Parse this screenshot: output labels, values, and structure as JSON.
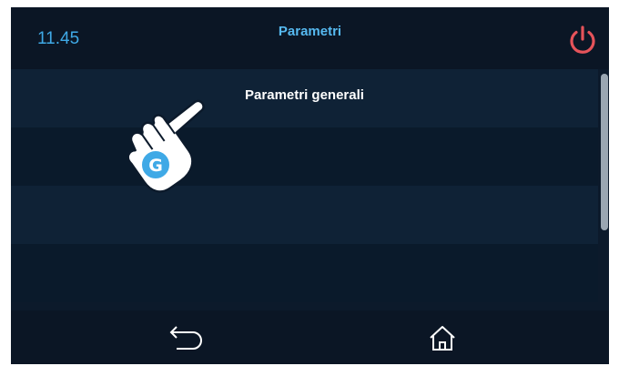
{
  "status_bar": {
    "time": "11.45",
    "title": "Parametri",
    "power_icon": "power-icon"
  },
  "list": {
    "items": [
      {
        "label": "Parametri generali"
      },
      {
        "label": ""
      },
      {
        "label": ""
      },
      {
        "label": ""
      }
    ]
  },
  "overlay": {
    "hand_icon": "pointing-hand-icon",
    "badge_letter": "G"
  },
  "nav": {
    "back_icon": "back-arrow-icon",
    "home_icon": "home-icon"
  },
  "colors": {
    "accent": "#3fa9e6",
    "power": "#e5535a",
    "background": "#0c1a2b"
  }
}
